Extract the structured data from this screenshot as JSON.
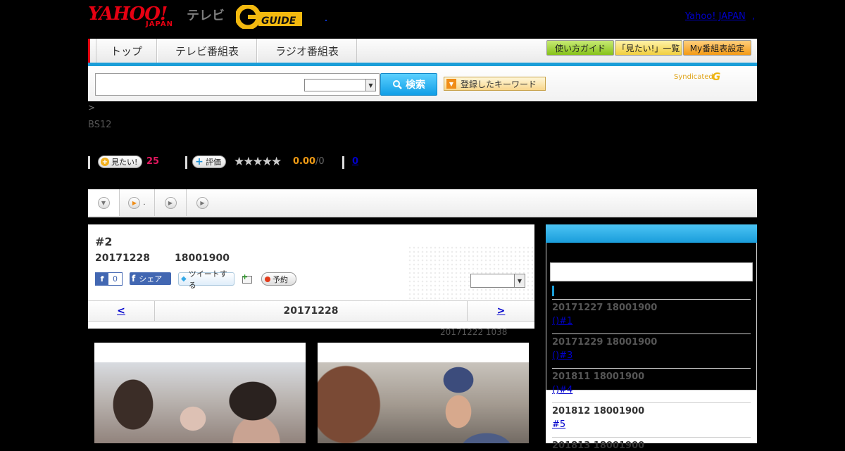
{
  "header": {
    "logo_yahoo": "YAHOO!",
    "logo_japan": "JAPAN",
    "logo_tv": "テレビ",
    "logo_gguide": "GUIDE",
    "yahoo_japan_link": "Yahoo! JAPAN",
    "yahoo_japan_link_suffix": ","
  },
  "nav": {
    "tabs": [
      {
        "label": "トップ"
      },
      {
        "label": "テレビ番組表"
      },
      {
        "label": "ラジオ番組表"
      }
    ],
    "utility_buttons": [
      {
        "label": "使い方ガイド"
      },
      {
        "label": "「見たい!」一覧"
      },
      {
        "label": "My番組表設定"
      }
    ]
  },
  "search": {
    "input_value": "",
    "select_value": "",
    "button_label": "検索",
    "keyword_button_label": "登録したキーワード",
    "syndicated_label": "Syndicated",
    "syndicated_logo": "G"
  },
  "breadcrumb": ">",
  "channel": "BS12",
  "stats": {
    "want_label": "見たい!",
    "want_count": "25",
    "rate_label": "評価",
    "stars": "★★★★★",
    "rating": "0.00",
    "rating_total": "/0",
    "review_count": "0"
  },
  "episode": {
    "title": "#2",
    "date": "20171228",
    "time": "18001900",
    "fb_like_count": "0",
    "fb_share_label": "シェア",
    "tweet_label": "ツイートする",
    "reserve_label": "予約",
    "select_value": "",
    "pager": {
      "prev": "<",
      "current": "20171228",
      "next": ">"
    },
    "updated": "20171222  1038"
  },
  "sidebar": {
    "items": [
      {
        "date": "20171227  18001900",
        "link": "()#1        "
      },
      {
        "date": "20171229  18001900",
        "link": "()#3        "
      },
      {
        "date": "201811  18001900",
        "link": "()#4        "
      },
      {
        "date": "201812  18001900",
        "link": "#5       "
      },
      {
        "date": "201813  18001900",
        "link": ""
      }
    ]
  },
  "colors": {
    "accent_blue": "#1b9ed8",
    "brand_red": "#e60012",
    "want_pink": "#e3175f",
    "rating_orange": "#f09b15"
  }
}
